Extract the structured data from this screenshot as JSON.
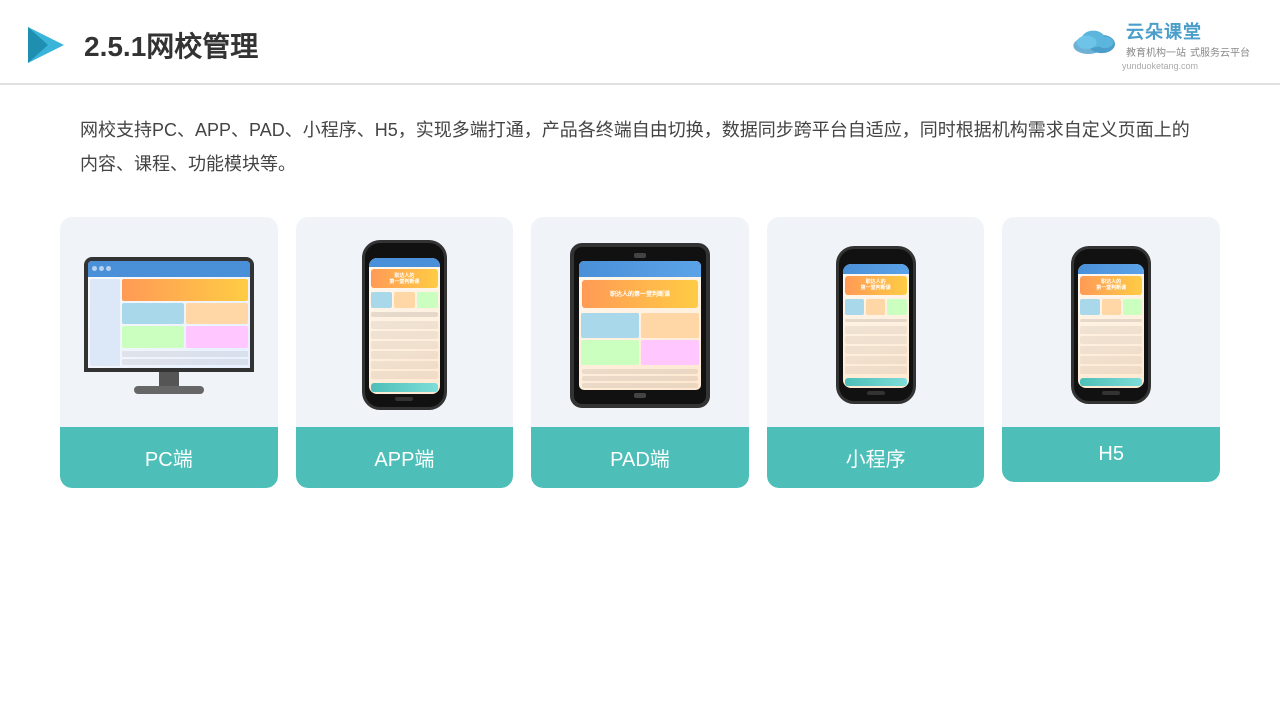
{
  "header": {
    "section_number": "2.5.1",
    "title": "网校管理",
    "logo": {
      "main": "云朵课堂",
      "domain": "yunduoketang.com",
      "subtitle": "教育机构一站",
      "subtitle2": "式服务云平台"
    }
  },
  "description": {
    "text": "网校支持PC、APP、PAD、小程序、H5，实现多端打通，产品各终端自由切换，数据同步跨平台自适应，同时根据机构需求自定义页面上的内容、课程、功能模块等。"
  },
  "cards": [
    {
      "id": "pc",
      "label": "PC端"
    },
    {
      "id": "app",
      "label": "APP端"
    },
    {
      "id": "pad",
      "label": "PAD端"
    },
    {
      "id": "miniprogram",
      "label": "小程序"
    },
    {
      "id": "h5",
      "label": "H5"
    }
  ],
  "colors": {
    "accent": "#4dbfb8",
    "title": "#333333",
    "card_bg": "#f0f4f8"
  }
}
